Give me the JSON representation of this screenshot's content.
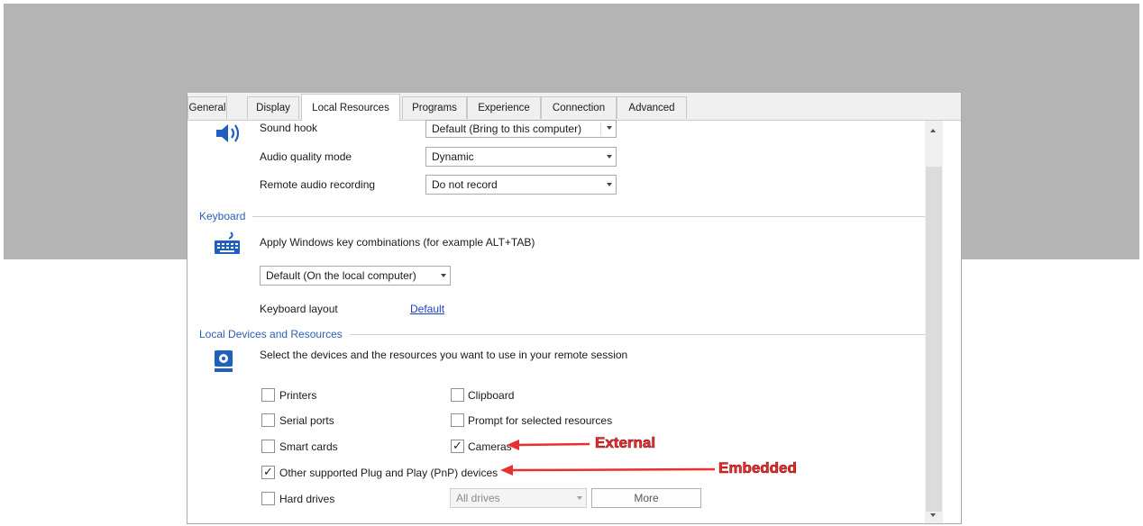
{
  "tabs": [
    {
      "label": "General"
    },
    {
      "label": "Display"
    },
    {
      "label": "Local Resources"
    },
    {
      "label": "Programs"
    },
    {
      "label": "Experience"
    },
    {
      "label": "Connection"
    },
    {
      "label": "Advanced"
    }
  ],
  "active_tab": "Local Resources",
  "audio": {
    "sound_hook_label": "Sound hook",
    "sound_hook_value": "Default (Bring to this computer)",
    "quality_label": "Audio quality mode",
    "quality_value": "Dynamic",
    "recording_label": "Remote audio recording",
    "recording_value": "Do not record"
  },
  "keyboard": {
    "section_title": "Keyboard",
    "description": "Apply Windows key combinations (for example ALT+TAB)",
    "combo_value": "Default (On the local computer)",
    "layout_label": "Keyboard layout",
    "layout_link": "Default"
  },
  "devices": {
    "section_title": "Local Devices and Resources",
    "description": "Select the devices and the resources you want to use in your remote session",
    "items": [
      {
        "label": "Printers",
        "checked": false
      },
      {
        "label": "Clipboard",
        "checked": false
      },
      {
        "label": "Serial ports",
        "checked": false
      },
      {
        "label": "Prompt for selected resources",
        "checked": false
      },
      {
        "label": "Smart cards",
        "checked": false
      },
      {
        "label": "Cameras",
        "checked": true
      },
      {
        "label": "Other supported Plug and Play (PnP) devices",
        "checked": true
      },
      {
        "label": "Hard drives",
        "checked": false
      }
    ],
    "drives_value": "All drives",
    "more_label": "More"
  },
  "annotations": {
    "external": "External",
    "embedded": "Embedded",
    "color": "#e83030"
  },
  "check_glyph": "✓"
}
